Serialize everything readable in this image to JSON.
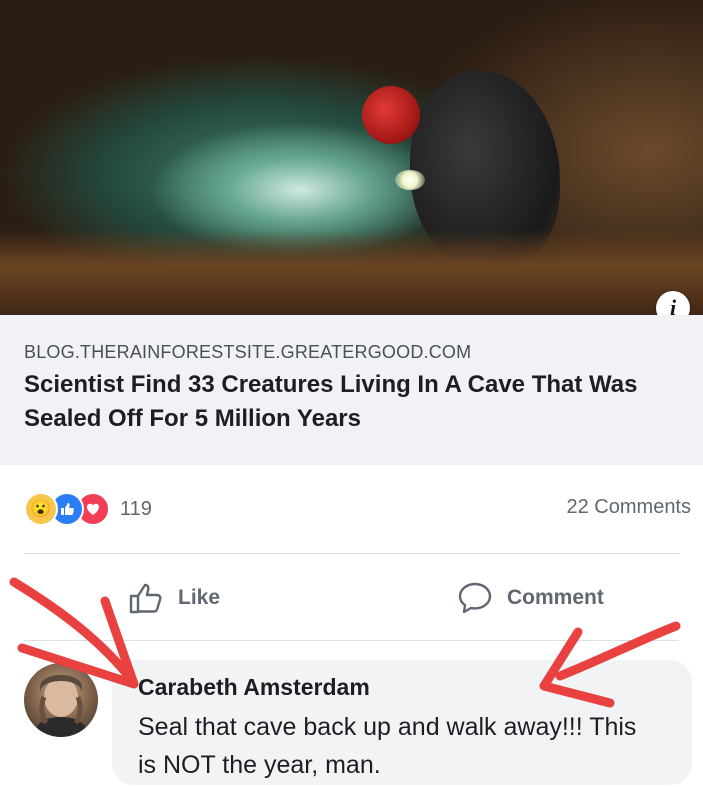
{
  "post": {
    "image": {
      "description_icon": "info-icon",
      "info_glyph": "i"
    },
    "link": {
      "domain": "BLOG.THERAINFORESTSITE.GREATERGOOD.COM",
      "title": "Scientist Find 33 Creatures Living In A Cave That Was Sealed Off For 5 Million Years"
    },
    "reactions": {
      "icons": [
        "wow-reaction-icon",
        "like-reaction-icon",
        "love-reaction-icon"
      ],
      "count": "119",
      "comments": "22 Comments"
    },
    "actions": {
      "like_label": "Like",
      "comment_label": "Comment"
    }
  },
  "comment": {
    "author": "Carabeth Amsterdam",
    "text": "Seal that cave back up and walk away!!! This is NOT the year, man."
  },
  "colors": {
    "annotation_arrow": "#e8413f",
    "link_card_bg": "#f1f2f5",
    "comment_bubble_bg": "#f2f3f5",
    "secondary_text": "#606770"
  }
}
